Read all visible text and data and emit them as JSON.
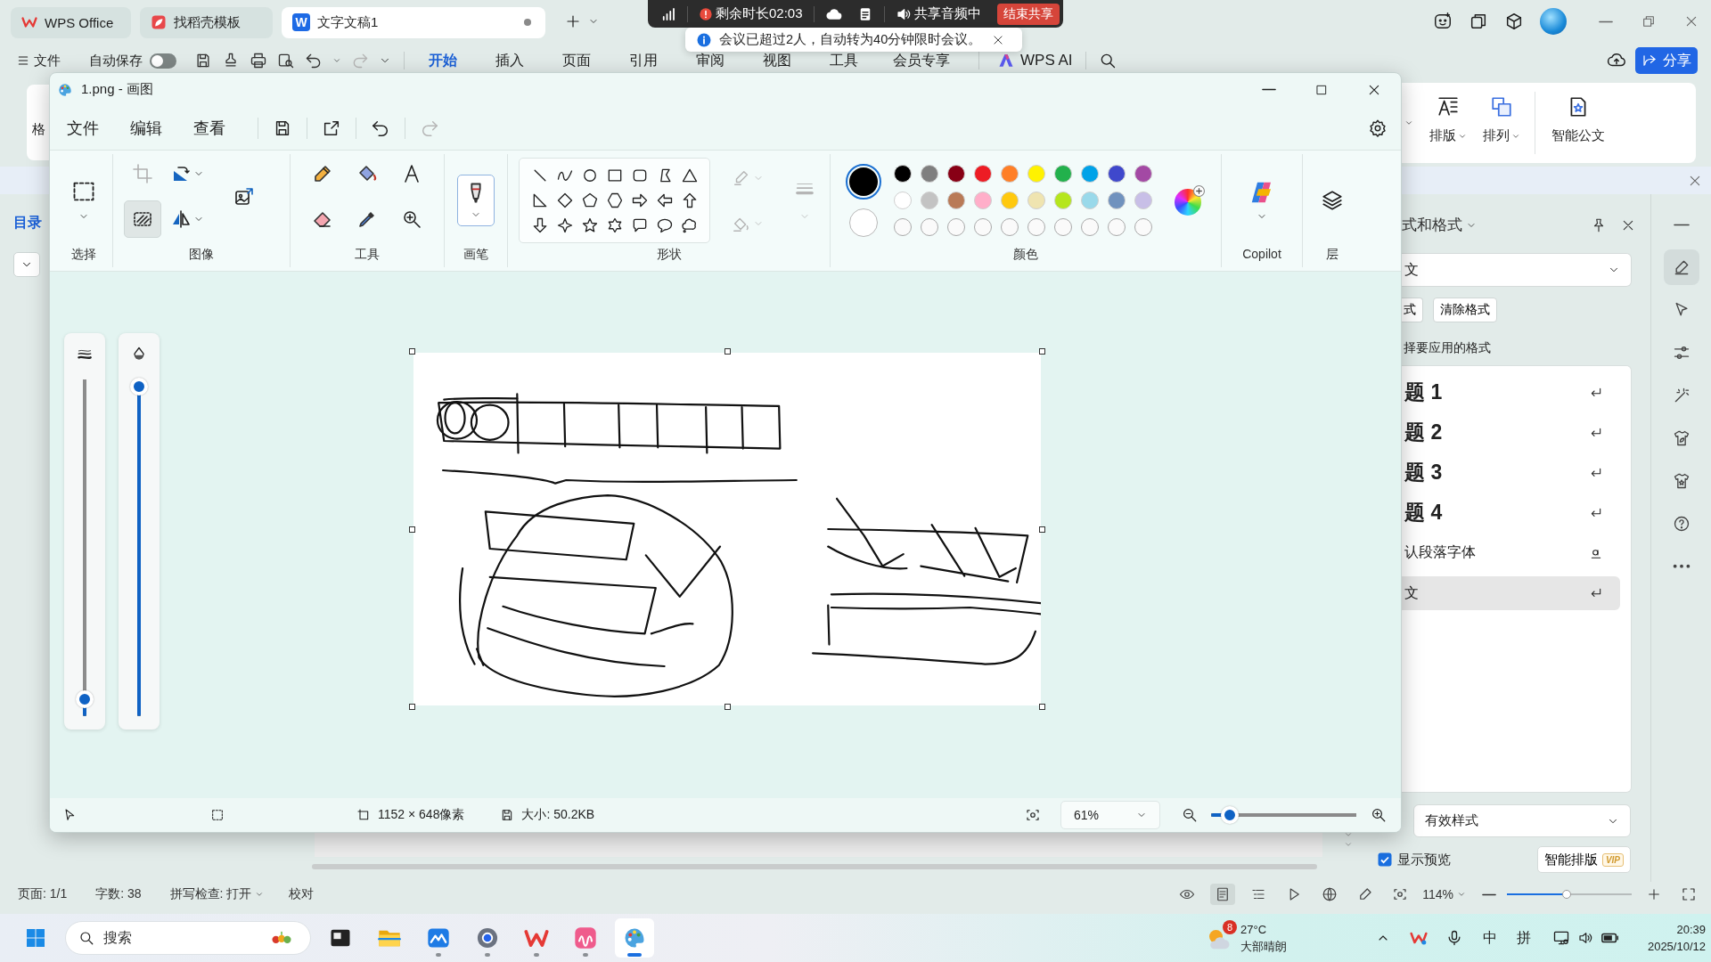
{
  "wps_tabs": [
    {
      "label": "WPS Office",
      "kind": "home",
      "unsaved": false,
      "selected": false
    },
    {
      "label": "找稻壳模板",
      "kind": "template",
      "unsaved": false,
      "selected": false
    },
    {
      "label": "文字文稿1",
      "kind": "document",
      "badge": "W",
      "unsaved": true,
      "selected": true
    }
  ],
  "meeting_bar": {
    "remaining": "剩余时长02:03",
    "audio": "共享音频中",
    "end_button": "结束共享"
  },
  "notification": {
    "text": "会议已超过2人，自动转为40分钟限时会议。"
  },
  "wps_menu": {
    "file": "文件",
    "autosave": {
      "label": "自动保存",
      "on": false
    },
    "quick_actions": [
      {
        "kind": "save",
        "disabled": false
      },
      {
        "kind": "stamp",
        "disabled": false
      },
      {
        "kind": "print",
        "disabled": false
      },
      {
        "kind": "preview",
        "disabled": false
      },
      {
        "kind": "undo",
        "disabled": false
      },
      {
        "kind": "redo",
        "disabled": true
      }
    ],
    "tabs": [
      {
        "label": "开始",
        "selected": true
      },
      {
        "label": "插入",
        "selected": false
      },
      {
        "label": "页面",
        "selected": false
      },
      {
        "label": "引用",
        "selected": false
      },
      {
        "label": "审阅",
        "selected": false
      },
      {
        "label": "视图",
        "selected": false
      },
      {
        "label": "工具",
        "selected": false
      },
      {
        "label": "会员专享",
        "selected": false
      }
    ],
    "ai": "WPS AI",
    "share": "分享"
  },
  "wps_ribbon": {
    "left_fragment": "格",
    "items": [
      {
        "kind": "layout",
        "label": "排版",
        "dropdown": true
      },
      {
        "kind": "arrange",
        "label": "排列",
        "dropdown": true
      },
      {
        "kind": "smart-doc",
        "label": "智能公文",
        "dropdown": false
      }
    ]
  },
  "nav": {
    "label": "目录"
  },
  "styles_panel": {
    "title": "式和格式",
    "current": "文",
    "buttons": [
      "式",
      "清除格式"
    ],
    "hint": "择要应用的格式",
    "styles": [
      {
        "label": "题 1",
        "kind": "heading",
        "selected": false
      },
      {
        "label": "题 2",
        "kind": "heading",
        "selected": false
      },
      {
        "label": "题 3",
        "kind": "heading",
        "selected": false
      },
      {
        "label": "题 4",
        "kind": "heading",
        "selected": false
      },
      {
        "label": "认段落字体",
        "kind": "font",
        "selected": false
      },
      {
        "label": "文",
        "kind": "paragraph",
        "selected": true
      }
    ],
    "show": "有效样式",
    "preview": {
      "label": "显示预览",
      "checked": true
    },
    "smart_layout": {
      "label": "智能排版",
      "badge": "VIP"
    }
  },
  "side_toolbar": [
    {
      "kind": "collapse",
      "selected": false
    },
    {
      "kind": "pen",
      "selected": true
    },
    {
      "kind": "cursor",
      "selected": false
    },
    {
      "kind": "sliders",
      "selected": false
    },
    {
      "kind": "wand",
      "selected": false
    },
    {
      "kind": "leaf-shirt",
      "selected": false
    },
    {
      "kind": "star-shirt",
      "selected": false
    },
    {
      "kind": "help",
      "selected": false
    },
    {
      "kind": "more",
      "selected": false
    }
  ],
  "wps_status": {
    "page": "页面: 1/1",
    "words": "字数: 38",
    "spell": "拼写检查: 打开",
    "proofread": "校对",
    "views": [
      {
        "kind": "reading",
        "selected": false
      },
      {
        "kind": "page",
        "selected": true
      },
      {
        "kind": "outline",
        "selected": false
      },
      {
        "kind": "play",
        "selected": false
      },
      {
        "kind": "web",
        "selected": false
      },
      {
        "kind": "pen",
        "selected": false
      }
    ],
    "zoom": "114%",
    "zoom_slider": {
      "level": 0.48
    }
  },
  "paint": {
    "title": "1.png - 画图",
    "menu": [
      "文件",
      "编辑",
      "查看"
    ],
    "actions": [
      {
        "kind": "save",
        "disabled": false
      },
      {
        "kind": "share",
        "disabled": false
      },
      {
        "kind": "undo",
        "disabled": false
      },
      {
        "kind": "redo",
        "disabled": true
      }
    ],
    "ribbon": {
      "select": {
        "label": "选择"
      },
      "image": {
        "label": "图像",
        "tools": [
          {
            "kind": "crop",
            "disabled": true,
            "selected": false
          },
          {
            "kind": "transparent",
            "disabled": false,
            "selected": true
          },
          {
            "kind": "rotate",
            "disabled": false,
            "selected": false
          },
          {
            "kind": "flip",
            "disabled": false,
            "selected": false
          },
          {
            "kind": "resize",
            "disabled": false,
            "selected": false
          }
        ]
      },
      "tools": {
        "label": "工具",
        "items": [
          {
            "kind": "pencil",
            "selected": false
          },
          {
            "kind": "fill",
            "selected": false
          },
          {
            "kind": "text",
            "selected": false
          },
          {
            "kind": "eraser",
            "selected": false
          },
          {
            "kind": "picker",
            "selected": false
          },
          {
            "kind": "magnifier",
            "selected": false
          }
        ]
      },
      "brushes": {
        "label": "画笔",
        "selected": true
      },
      "shapes": {
        "label": "形状",
        "items": [
          {
            "kind": "line",
            "selected": false
          },
          {
            "kind": "curve",
            "selected": false
          },
          {
            "kind": "oval",
            "selected": false
          },
          {
            "kind": "rectangle",
            "selected": false
          },
          {
            "kind": "rounded-rectangle",
            "selected": false
          },
          {
            "kind": "polygon",
            "selected": false
          },
          {
            "kind": "triangle",
            "selected": false
          },
          {
            "kind": "right-triangle",
            "selected": false
          },
          {
            "kind": "diamond",
            "selected": false
          },
          {
            "kind": "pentagon",
            "selected": false
          },
          {
            "kind": "hexagon",
            "selected": false
          },
          {
            "kind": "right-arrow",
            "selected": false
          },
          {
            "kind": "left-arrow",
            "selected": false
          },
          {
            "kind": "up-arrow",
            "selected": false
          },
          {
            "kind": "down-arrow",
            "selected": false
          },
          {
            "kind": "four-star",
            "selected": false
          },
          {
            "kind": "five-star",
            "selected": false
          },
          {
            "kind": "six-star",
            "selected": false
          },
          {
            "kind": "rect-callout",
            "selected": false
          },
          {
            "kind": "oval-callout",
            "selected": false
          },
          {
            "kind": "cloud-callout",
            "selected": false
          }
        ],
        "options": [
          {
            "kind": "outline",
            "disabled": true
          },
          {
            "kind": "fill",
            "disabled": true
          },
          {
            "kind": "size",
            "disabled": true
          }
        ]
      },
      "colors": {
        "label": "颜色",
        "active": [
          {
            "color": "#000000",
            "selected": true
          },
          {
            "color": "#ffffff",
            "selected": false
          }
        ],
        "palette": [
          {
            "kind": "swatch",
            "color": "#000000"
          },
          {
            "kind": "swatch",
            "color": "#7f7f7f"
          },
          {
            "kind": "swatch",
            "color": "#880015"
          },
          {
            "kind": "swatch",
            "color": "#ed1c24"
          },
          {
            "kind": "swatch",
            "color": "#ff7f27"
          },
          {
            "kind": "swatch",
            "color": "#fff200"
          },
          {
            "kind": "swatch",
            "color": "#22b14c"
          },
          {
            "kind": "swatch",
            "color": "#00a2e8"
          },
          {
            "kind": "swatch",
            "color": "#3f48cc"
          },
          {
            "kind": "swatch",
            "color": "#a349a4"
          },
          {
            "kind": "swatch",
            "color": "#ffffff"
          },
          {
            "kind": "swatch",
            "color": "#c3c3c3"
          },
          {
            "kind": "swatch",
            "color": "#b97a57"
          },
          {
            "kind": "swatch",
            "color": "#ffaec9"
          },
          {
            "kind": "swatch",
            "color": "#ffc90e"
          },
          {
            "kind": "swatch",
            "color": "#efe4b0"
          },
          {
            "kind": "swatch",
            "color": "#b5e61d"
          },
          {
            "kind": "swatch",
            "color": "#99d9ea"
          },
          {
            "kind": "swatch",
            "color": "#7092be"
          },
          {
            "kind": "swatch",
            "color": "#c8bfe7"
          },
          {
            "kind": "empty"
          },
          {
            "kind": "empty"
          },
          {
            "kind": "empty"
          },
          {
            "kind": "empty"
          },
          {
            "kind": "empty"
          },
          {
            "kind": "empty"
          },
          {
            "kind": "empty"
          },
          {
            "kind": "empty"
          },
          {
            "kind": "empty"
          },
          {
            "kind": "empty"
          }
        ]
      },
      "copilot": {
        "label": "Copilot"
      },
      "layers": {
        "label": "层"
      }
    },
    "sliders": [
      {
        "kind": "size",
        "level": 0.05
      },
      {
        "kind": "opacity",
        "level": 0.98
      }
    ],
    "status": {
      "dimensions": "1152 × 648像素",
      "file_size": "大小: 50.2KB",
      "zoom": "61%",
      "zoom_slider": {
        "level": 0.13
      }
    }
  },
  "taskbar": {
    "search": {
      "placeholder": "搜索"
    },
    "apps": [
      {
        "kind": "terminal",
        "running": false,
        "selected": false
      },
      {
        "kind": "folder",
        "running": false,
        "selected": false
      },
      {
        "kind": "board",
        "running": true,
        "selected": false
      },
      {
        "kind": "settings",
        "running": true,
        "selected": false
      },
      {
        "kind": "wps",
        "running": true,
        "selected": false
      },
      {
        "kind": "pink",
        "running": true,
        "selected": false
      },
      {
        "kind": "paint",
        "running": true,
        "selected": true
      }
    ],
    "weather": {
      "badge": "8",
      "temperature": "27°C",
      "condition": "大部晴朗"
    },
    "input_modes": [
      "中",
      "拼"
    ],
    "time": "20:39",
    "date": "2025/10/12"
  }
}
